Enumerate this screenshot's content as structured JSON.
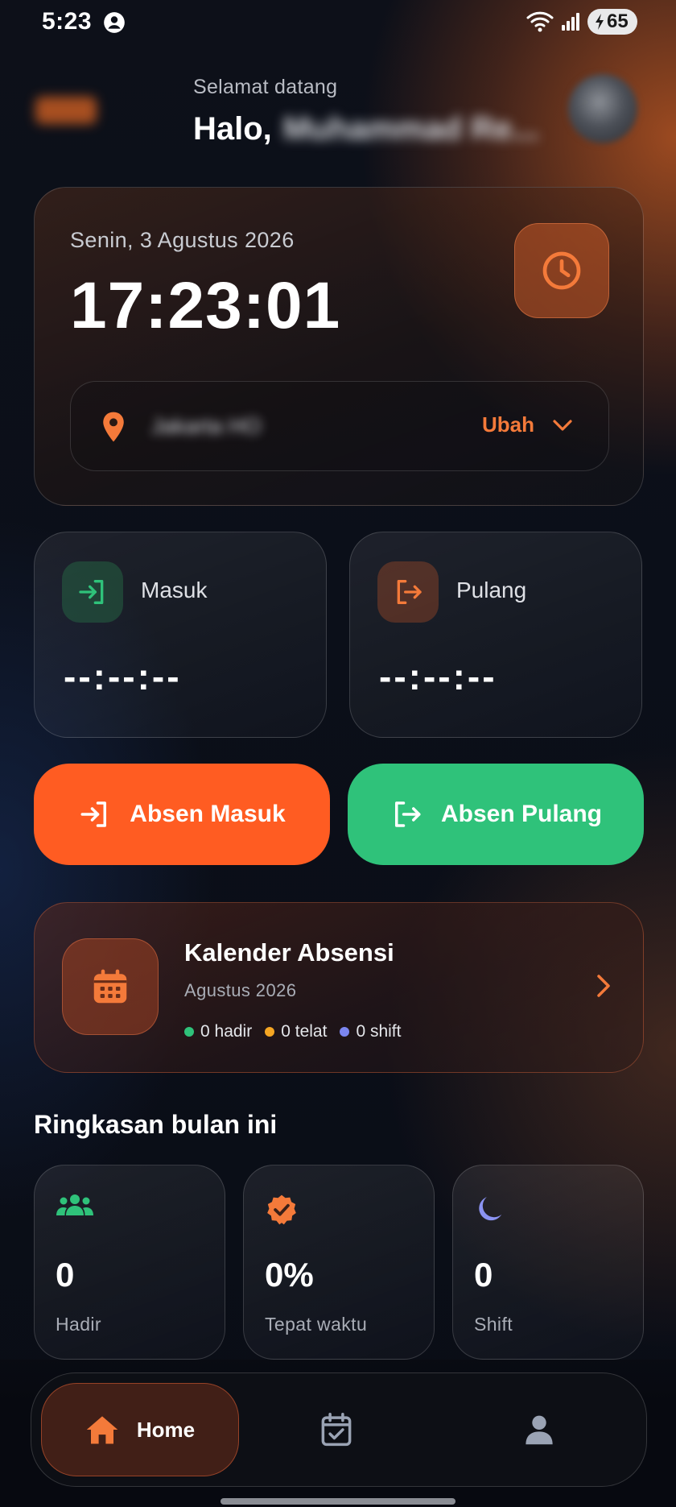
{
  "status_bar": {
    "time": "5:23",
    "battery": "65"
  },
  "header": {
    "greeting": "Selamat datang",
    "hello_prefix": "Halo,",
    "user_name": "Muhammad Re..."
  },
  "time_card": {
    "date": "Senin, 3 Agustus 2026",
    "clock": "17:23:01",
    "location_name": "Jakarta HO",
    "change_label": "Ubah"
  },
  "attendance": {
    "check_in": {
      "label": "Masuk",
      "value": "--:--:--"
    },
    "check_out": {
      "label": "Pulang",
      "value": "--:--:--"
    }
  },
  "actions": {
    "check_in_label": "Absen Masuk",
    "check_out_label": "Absen Pulang"
  },
  "calendar": {
    "title": "Kalender Absensi",
    "month": "Agustus 2026",
    "stats": [
      {
        "label": "0 hadir",
        "color": "#2fc27a"
      },
      {
        "label": "0 telat",
        "color": "#f5a623"
      },
      {
        "label": "0 shift",
        "color": "#7b86f0"
      }
    ]
  },
  "summary": {
    "title": "Ringkasan bulan ini",
    "cards": [
      {
        "value": "0",
        "label": "Hadir",
        "icon": "people-icon",
        "color": "#2fc27a"
      },
      {
        "value": "0%",
        "label": "Tepat waktu",
        "icon": "verified-badge-icon",
        "color": "#f47a3a"
      },
      {
        "value": "0",
        "label": "Shift",
        "icon": "moon-icon",
        "color": "#8b93f2"
      }
    ]
  },
  "bottom_nav": {
    "home_label": "Home",
    "items": [
      "home-icon",
      "calendar-check-icon",
      "profile-icon"
    ]
  },
  "colors": {
    "accent_orange": "#ff5c22",
    "accent_green": "#2fc27a",
    "text_orange": "#f47a3a"
  }
}
